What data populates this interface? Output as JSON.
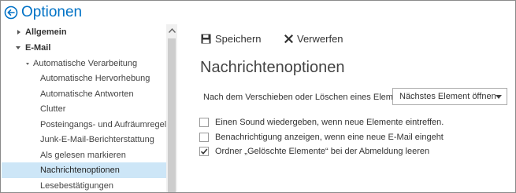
{
  "header": {
    "title": "Optionen",
    "accent_color": "#0072c6"
  },
  "nav": {
    "items": [
      {
        "label": "Allgemein",
        "level": 1,
        "expander": "collapsed"
      },
      {
        "label": "E-Mail",
        "level": 1,
        "expander": "expanded"
      },
      {
        "label": "Automatische Verarbeitung",
        "level": 2,
        "expander": "expanded"
      },
      {
        "label": "Automatische Hervorhebung",
        "level": 3
      },
      {
        "label": "Automatische Antworten",
        "level": 3
      },
      {
        "label": "Clutter",
        "level": 3
      },
      {
        "label": "Posteingangs- und Aufräumregeln",
        "level": 3
      },
      {
        "label": "Junk-E-Mail-Berichterstattung",
        "level": 3
      },
      {
        "label": "Als gelesen markieren",
        "level": 3
      },
      {
        "label": "Nachrichtenoptionen",
        "level": 3,
        "selected": true
      },
      {
        "label": "Lesebestätigungen",
        "level": 3
      }
    ],
    "selected_color": "#cde6f7"
  },
  "toolbar": {
    "save_label": "Speichern",
    "save_icon": "floppy-disk-icon",
    "discard_label": "Verwerfen",
    "discard_icon": "x-icon"
  },
  "main": {
    "section_title": "Nachrichtenoptionen",
    "after_move_label": "Nach dem Verschieben oder Löschen eines Elements",
    "after_move_value": "Nächstes Element öffnen",
    "options": [
      {
        "label": "Einen Sound wiedergeben, wenn neue Elemente eintreffen.",
        "checked": false
      },
      {
        "label": "Benachrichtigung anzeigen, wenn eine neue E-Mail eingeht",
        "checked": false
      },
      {
        "label": "Ordner „Gelöschte Elemente“ bei der Abmeldung leeren",
        "checked": true
      }
    ]
  }
}
